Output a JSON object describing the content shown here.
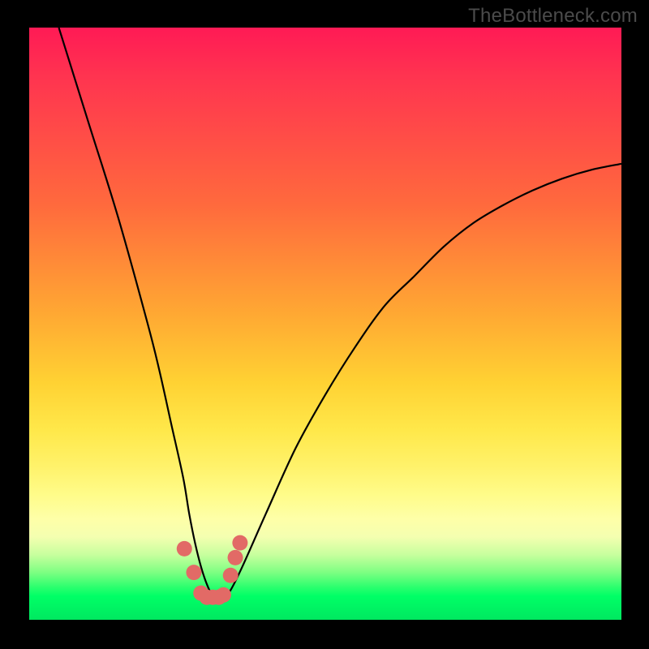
{
  "watermark": "TheBottleneck.com",
  "chart_data": {
    "type": "line",
    "title": "",
    "xlabel": "",
    "ylabel": "",
    "xlim": [
      0,
      100
    ],
    "ylim": [
      0,
      100
    ],
    "grid": false,
    "legend": false,
    "annotations": [],
    "series": [
      {
        "name": "bottleneck-curve",
        "color": "#000000",
        "x": [
          5,
          10,
          15,
          20,
          22,
          24,
          26,
          27,
          28,
          29,
          30,
          31,
          32,
          33,
          34,
          36,
          40,
          45,
          50,
          55,
          60,
          65,
          70,
          75,
          80,
          85,
          90,
          95,
          100
        ],
        "values": [
          100,
          84,
          68,
          50,
          42,
          33,
          24,
          18,
          13,
          9,
          6,
          4,
          4,
          4,
          5,
          9,
          18,
          29,
          38,
          46,
          53,
          58,
          63,
          67,
          70,
          72.5,
          74.5,
          76,
          77
        ]
      }
    ],
    "markers": {
      "name": "minimum-region-dots",
      "color": "#e26a66",
      "x": [
        26.2,
        27.8,
        29.0,
        30.0,
        31.0,
        32.0,
        32.8,
        34.0,
        34.8,
        35.6
      ],
      "values": [
        12.0,
        8.0,
        4.5,
        3.8,
        3.8,
        3.8,
        4.2,
        7.5,
        10.5,
        13.0
      ]
    },
    "gradient_stops": [
      {
        "pos": 0.0,
        "color": "#ff1a55"
      },
      {
        "pos": 0.3,
        "color": "#ff6a3d"
      },
      {
        "pos": 0.6,
        "color": "#ffd233"
      },
      {
        "pos": 0.83,
        "color": "#feffa8"
      },
      {
        "pos": 0.92,
        "color": "#7dff82"
      },
      {
        "pos": 1.0,
        "color": "#00e860"
      }
    ]
  }
}
